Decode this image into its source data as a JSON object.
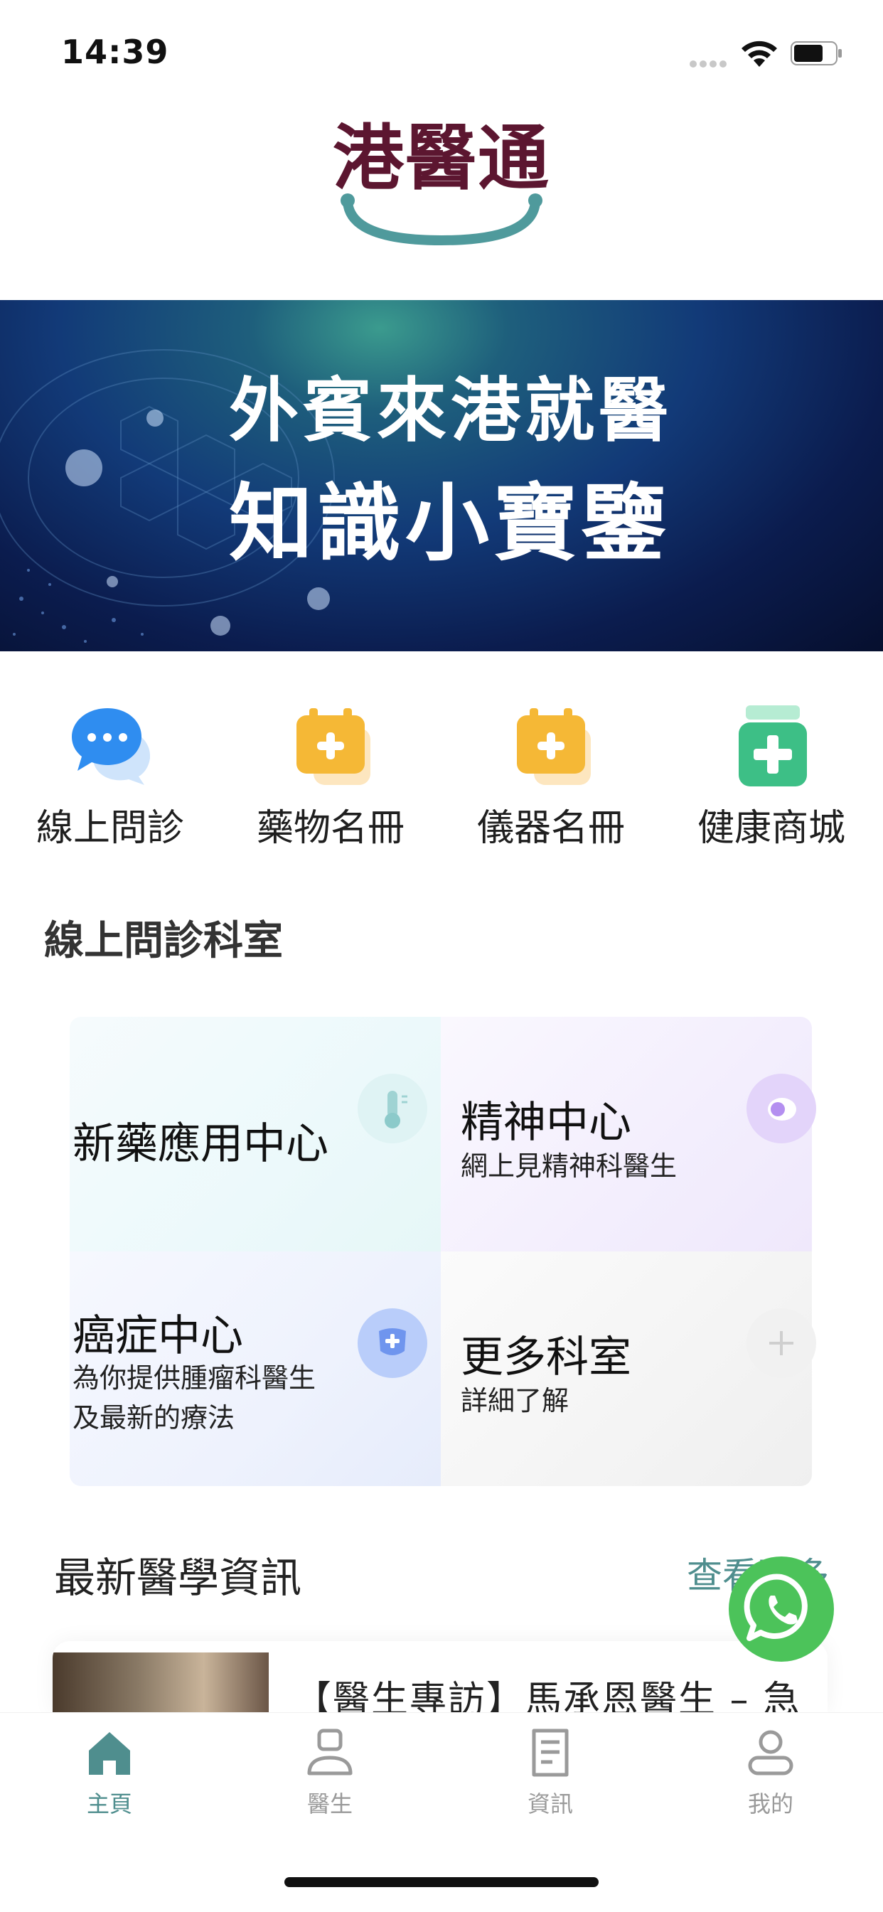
{
  "status_bar": {
    "time": "14:39",
    "icons": [
      "signal-dots-icon",
      "wifi-icon",
      "battery-icon"
    ]
  },
  "logo": {
    "text": "港醫通",
    "color": "#5c1630",
    "accent": "#4f9a9c"
  },
  "banner": {
    "line1": "外賓來港就醫",
    "line2": "知識小寶鑒"
  },
  "quick_menu": [
    {
      "label": "線上問診",
      "icon": "chat-bubbles-icon"
    },
    {
      "label": "藥物名冊",
      "icon": "medicine-box-icon"
    },
    {
      "label": "儀器名冊",
      "icon": "instrument-box-icon"
    },
    {
      "label": "健康商城",
      "icon": "medicine-bottle-icon"
    }
  ],
  "departments": {
    "section_title": "線上問診科室",
    "items": [
      {
        "title": "新藥應用中心",
        "desc": "",
        "icon": "thermometer-icon"
      },
      {
        "title": "精神中心",
        "desc": "網上見精神科醫生",
        "icon": "mind-icon"
      },
      {
        "title": "癌症中心",
        "desc_line1": "為你提供腫瘤科醫生",
        "desc_line2": "及最新的療法",
        "icon": "cancer-shield-icon"
      },
      {
        "title": "更多科室",
        "desc": "詳細了解",
        "icon": "plus-icon"
      }
    ]
  },
  "news": {
    "section_title": "最新醫學資訊",
    "more_label": "查看更多",
    "first_item": {
      "title": "【醫生專訪】馬承恩醫生 – 急"
    }
  },
  "floating": {
    "icon": "whatsapp-icon",
    "color": "#4cc35a"
  },
  "tab_bar": {
    "active_color": "#4f8e8e",
    "items": [
      {
        "label": "主頁",
        "icon": "home-icon",
        "active": true
      },
      {
        "label": "醫生",
        "icon": "doctor-icon",
        "active": false
      },
      {
        "label": "資訊",
        "icon": "news-icon",
        "active": false
      },
      {
        "label": "我的",
        "icon": "profile-icon",
        "active": false
      }
    ]
  }
}
